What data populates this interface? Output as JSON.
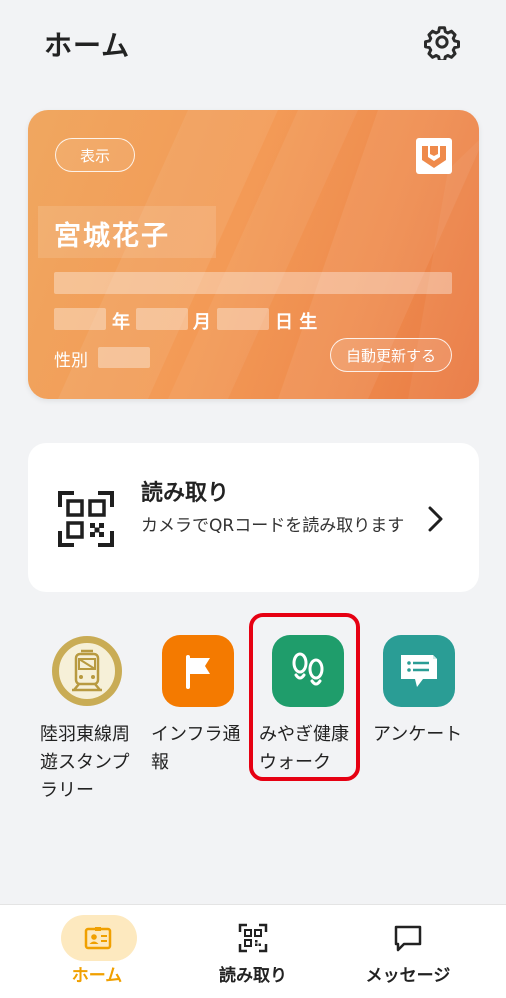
{
  "header": {
    "title": "ホーム",
    "settings_icon": "gear-icon"
  },
  "card": {
    "show_label": "表示",
    "name": "宮城花子",
    "year_suffix": "年",
    "month_suffix": "月",
    "day_suffix": "日 生",
    "gender_label": "性別",
    "refresh_label": "自動更新する",
    "logo_icon": "card-logo-icon",
    "gradient_start": "#f0a760",
    "gradient_end": "#e97942"
  },
  "scan": {
    "title": "読み取り",
    "description": "カメラでQRコードを読み取ります",
    "icon": "qr-code-icon"
  },
  "apps": [
    {
      "label": "陸羽東線周遊スタンプラリー",
      "icon": "train-icon",
      "color": "#c9ac55"
    },
    {
      "label": "インフラ通報",
      "icon": "flag-icon",
      "color": "#f47a00"
    },
    {
      "label": "みやぎ健康ウォーク",
      "icon": "footprints-icon",
      "color": "#1f9d6b"
    },
    {
      "label": "アンケート",
      "icon": "survey-icon",
      "color": "#2a9d95"
    }
  ],
  "highlight_color": "#e60012",
  "bottom_nav": {
    "items": [
      {
        "label": "ホーム",
        "icon": "id-card-icon",
        "active": true
      },
      {
        "label": "読み取り",
        "icon": "qr-scan-icon",
        "active": false
      },
      {
        "label": "メッセージ",
        "icon": "message-icon",
        "active": false
      }
    ],
    "active_color": "#f0a000"
  }
}
